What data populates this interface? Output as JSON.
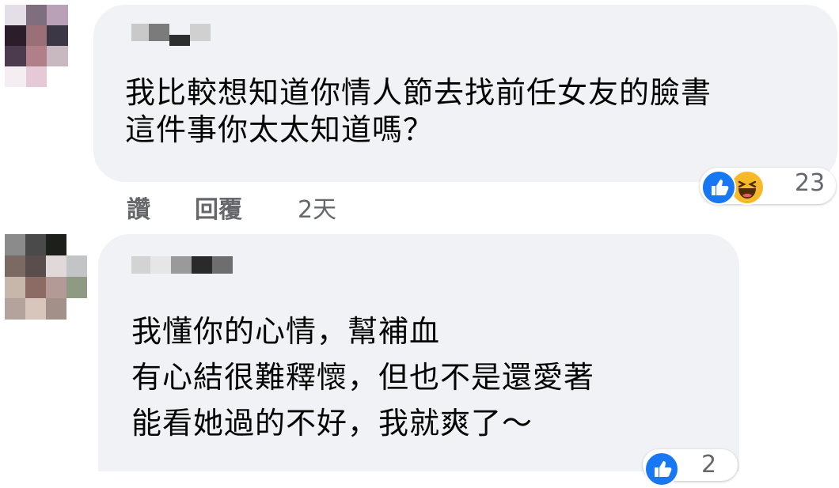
{
  "comments": [
    {
      "text_lines": [
        "我比較想知道你情人節去找前任女友的臉書",
        "這件事你太太知道嗎？"
      ],
      "actions": {
        "like_label": "讚",
        "reply_label": "回覆",
        "timestamp": "2天"
      },
      "reactions": {
        "icons": [
          "like-icon",
          "haha-icon"
        ],
        "count": "23"
      }
    },
    {
      "text_lines": [
        "我懂你的心情，幫補血",
        "有心結很難釋懷，但也不是還愛著",
        "能看她過的不好，我就爽了～"
      ],
      "reactions": {
        "icons": [
          "like-icon"
        ],
        "count": "2"
      }
    }
  ],
  "colors": {
    "bubble": "#f0f2f5",
    "like_blue": "#1877f2",
    "haha_yellow": "#f7b928",
    "meta_gray": "#65676b"
  }
}
